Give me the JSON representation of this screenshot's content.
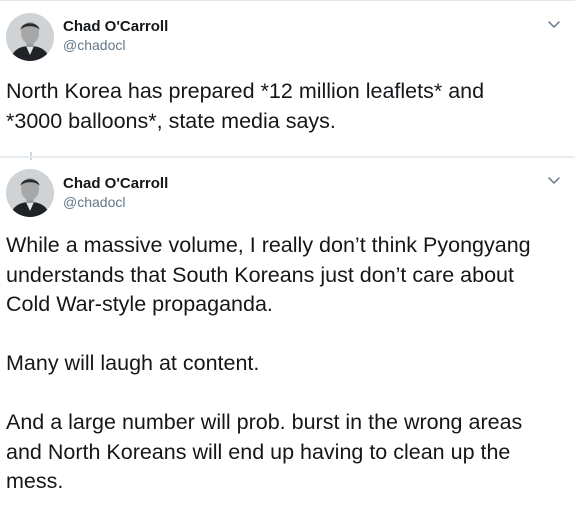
{
  "tweets": [
    {
      "author": {
        "name": "Chad O'Carroll",
        "handle": "@chadocl"
      },
      "text": "North Korea has prepared *12 million leaflets* and\n*3000 balloons*, state media says."
    },
    {
      "author": {
        "name": "Chad O'Carroll",
        "handle": "@chadocl"
      },
      "text": "While a massive volume, I really don’t think Pyongyang\nunderstands that South Koreans just don’t care about\nCold War-style propaganda.\n\nMany will laugh at content.\n\nAnd a large number will prob. burst in the wrong areas\nand North Koreans will end up having to clean up the\nmess."
    }
  ],
  "icons": {
    "menu": "chevron-down-icon",
    "avatar": "avatar-photo"
  },
  "colors": {
    "name": "#14171a",
    "handle": "#657786",
    "divider": "#e6ecf0",
    "chevron": "#657786"
  }
}
